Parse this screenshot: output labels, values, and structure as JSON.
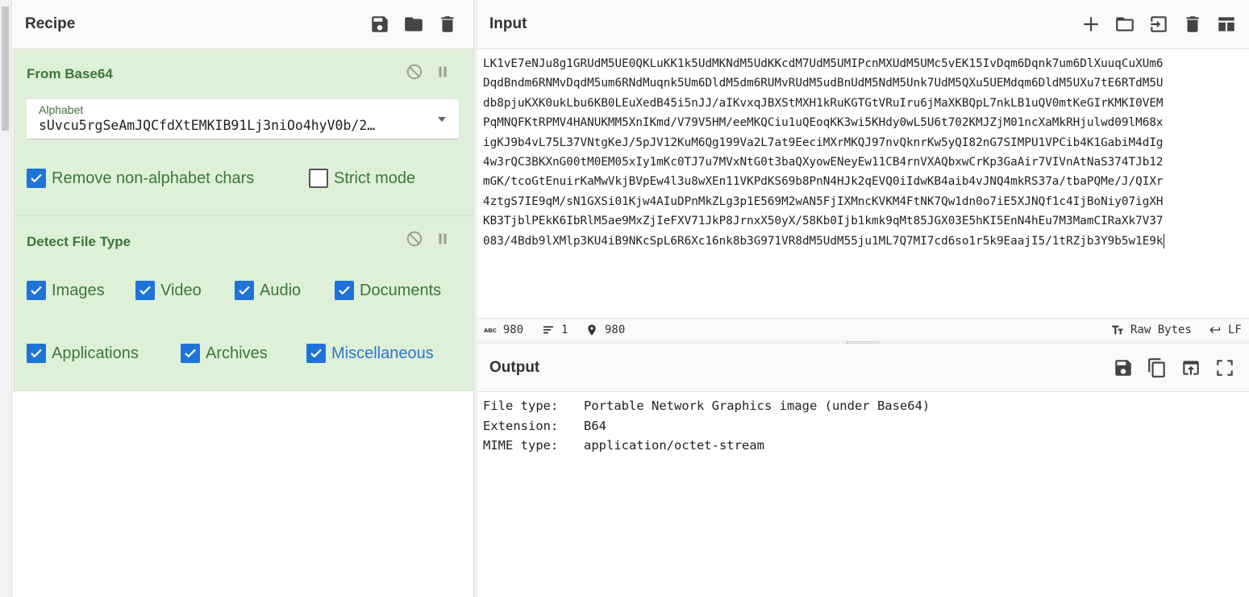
{
  "recipe": {
    "title": "Recipe",
    "icons": [
      "save-icon",
      "folder-icon",
      "trash-icon"
    ]
  },
  "operations": {
    "from_base64": {
      "title": "From Base64",
      "alphabet_label": "Alphabet",
      "alphabet_value": "sUvcu5rgSeAmJQCfdXtEMKIB91Lj3niOo4hyV0b/2…",
      "remove_non_alphabet": {
        "label": "Remove non-alphabet chars",
        "checked": true
      },
      "strict_mode": {
        "label": "Strict mode",
        "checked": false
      }
    },
    "detect_file_type": {
      "title": "Detect File Type",
      "options": [
        {
          "label": "Images",
          "checked": true
        },
        {
          "label": "Video",
          "checked": true
        },
        {
          "label": "Audio",
          "checked": true
        },
        {
          "label": "Documents",
          "checked": true
        },
        {
          "label": "Applications",
          "checked": true
        },
        {
          "label": "Archives",
          "checked": true
        },
        {
          "label": "Miscellaneous",
          "checked": true
        }
      ]
    }
  },
  "input": {
    "title": "Input",
    "lines": [
      "LK1vE7eNJu8g1GRUdM5UE0QKLuKK1k5UdMKNdM5UdKKcdM7UdM5UMIPcnMXUdM5UMc5vEK15IvDqm6Dqnk7um6DlXuuqCuXUm6",
      "DqdBndm6RNMvDqdM5um6RNdMuqnk5Um6DldM5dm6RUMvRUdM5udBnUdM5NdM5Unk7UdM5QXu5UEMdqm6DldM5UXu7tE6RTdM5U",
      "db8pjuKXK0ukLbu6KB0LEuXedB45i5nJJ/aIKvxqJBXStMXH1kRuKGTGtVRuIru6jMaXKBQpL7nkLB1uQV0mtKeGIrKMKI0VEM",
      "PqMNQFKtRPMV4HANUKMM5XnIKmd/V79V5HM/eeMKQCiu1uQEoqKK3wi5KHdy0wL5U6t702KMJZjM01ncXaMkRHjulwd09lM68x",
      "igKJ9b4vL75L37VNtgKeJ/5pJV12KuM6Qg199Va2L7at9EeciMXrMKQJ97nvQknrKw5yQI82nG7SIMPU1VPCib4K1GabiM4dIg",
      "4w3rQC3BKXnG00tM0EM05xIy1mKc0TJ7u7MVxNtG0t3baQXyowENeyEw11CB4rnVXAQbxwCrKp3GaAir7VIVnAtNaS374TJb12",
      "mGK/tcoGtEnuirKaMwVkjBVpEw4l3u8wXEn11VKPdKS69b8PnN4HJk2qEVQ0iIdwKB4aib4vJNQ4mkRS37a/tbaPQMe/J/QIXr",
      "4ztgS7IE9qM/sN1GXSi01Kjw4AIuDPnMkZLg3p1E569M2wAN5FjIXMncKVKM4FtNK7Qw1dn0o7iE5XJNQf1c4IjBoNiy07igXH",
      "KB3TjblPEkK6IbRlM5ae9MxZjIeFXV71JkP8JrnxX50yX/58Kb0Ijb1kmk9qMt85JGX03E5hKI5EnN4hEu7M3MamCIRaXk7V37",
      "083/4Bdb9lXMlp3KU4iB9NKcSpL6R6Xc16nk8b3G971VR8dM5UdM55ju1ML7Q7MI7cd6so1r5k9EaajI5/1tRZjb3Y9b5w1E9k"
    ],
    "icons": [
      "plus-icon",
      "open-folder-icon",
      "import-icon",
      "trash-icon",
      "layout-icon"
    ]
  },
  "status": {
    "length": "980",
    "lines": "1",
    "position": "980",
    "encoding": "Raw Bytes",
    "eol": "LF"
  },
  "output": {
    "title": "Output",
    "rows": [
      {
        "key": "File type:",
        "value": "Portable Network Graphics image (under Base64)"
      },
      {
        "key": "Extension:",
        "value": "B64"
      },
      {
        "key": "MIME type:",
        "value": "application/octet-stream"
      }
    ],
    "icons": [
      "save-icon",
      "copy-icon",
      "replace-input-icon",
      "maximize-icon"
    ]
  },
  "colors": {
    "op_background": "#dff0d8",
    "op_text": "#3c763d",
    "checkbox_on": "#1e73d8"
  }
}
